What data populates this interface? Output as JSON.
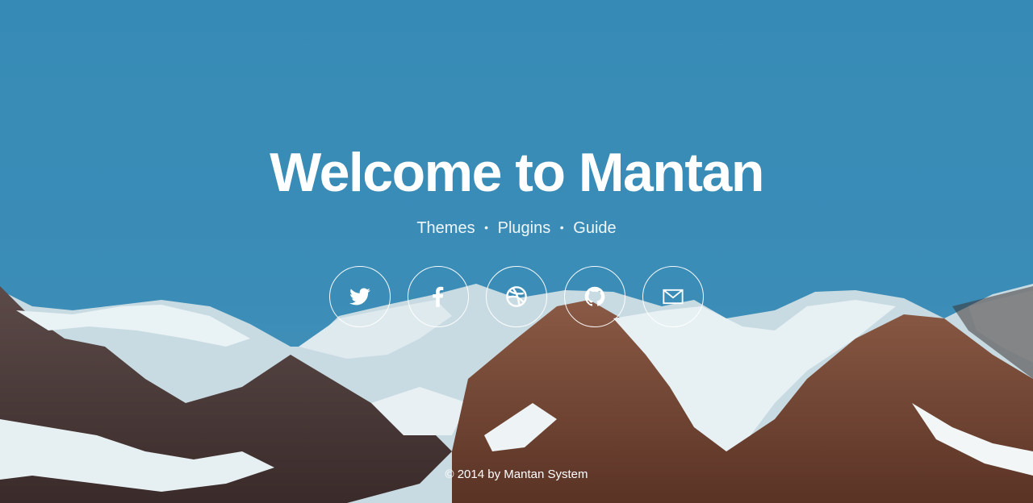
{
  "hero": {
    "title": "Welcome to Mantan",
    "background_sky": "#3a8ab3"
  },
  "nav": {
    "links": [
      "Themes",
      "Plugins",
      "Guide"
    ],
    "separator": "•"
  },
  "social": [
    {
      "icon": "twitter-icon"
    },
    {
      "icon": "facebook-icon"
    },
    {
      "icon": "dribbble-icon"
    },
    {
      "icon": "github-icon"
    },
    {
      "icon": "email-icon"
    }
  ],
  "footer": {
    "copyright": "© 2014 by Mantan System"
  }
}
